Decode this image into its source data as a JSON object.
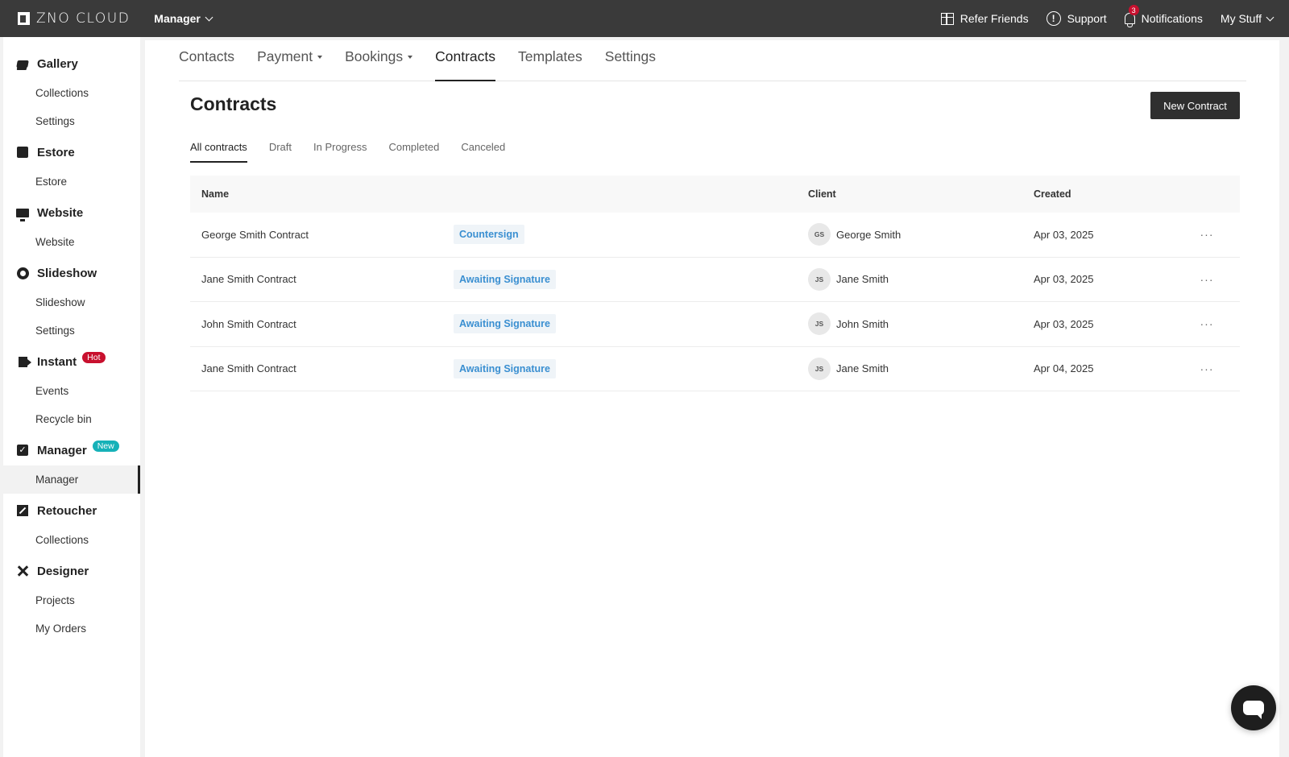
{
  "topbar": {
    "logo": "ZNO CLOUD",
    "app_switch": "Manager",
    "refer": "Refer Friends",
    "support": "Support",
    "support_glyph": "!",
    "notifications": "Notifications",
    "notif_count": "3",
    "my_stuff": "My Stuff"
  },
  "sidebar": {
    "gallery": {
      "label": "Gallery",
      "subs": [
        "Collections",
        "Settings"
      ]
    },
    "estore": {
      "label": "Estore",
      "subs": [
        "Estore"
      ]
    },
    "website": {
      "label": "Website",
      "subs": [
        "Website"
      ]
    },
    "slideshow": {
      "label": "Slideshow",
      "subs": [
        "Slideshow",
        "Settings"
      ]
    },
    "instant": {
      "label": "Instant",
      "pill": "Hot",
      "subs": [
        "Events",
        "Recycle bin"
      ]
    },
    "manager": {
      "label": "Manager",
      "pill": "New",
      "subs": [
        "Manager"
      ]
    },
    "retoucher": {
      "label": "Retoucher",
      "subs": [
        "Collections"
      ]
    },
    "designer": {
      "label": "Designer",
      "subs": [
        "Projects",
        "My Orders"
      ]
    }
  },
  "nav": {
    "contacts": "Contacts",
    "payment": "Payment",
    "bookings": "Bookings",
    "contracts": "Contracts",
    "templates": "Templates",
    "settings": "Settings"
  },
  "page": {
    "title": "Contracts",
    "new_button": "New Contract"
  },
  "subtabs": [
    "All contracts",
    "Draft",
    "In Progress",
    "Completed",
    "Canceled"
  ],
  "table": {
    "headers": {
      "name": "Name",
      "client": "Client",
      "created": "Created"
    },
    "more_glyph": "···",
    "rows": [
      {
        "name": "George Smith Contract",
        "status": "Countersign",
        "initials": "GS",
        "client": "George Smith",
        "created": "Apr 03, 2025"
      },
      {
        "name": "Jane Smith Contract",
        "status": "Awaiting Signature",
        "initials": "JS",
        "client": "Jane Smith",
        "created": "Apr 03, 2025"
      },
      {
        "name": "John Smith Contract",
        "status": "Awaiting Signature",
        "initials": "JS",
        "client": "John Smith",
        "created": "Apr 03, 2025"
      },
      {
        "name": "Jane Smith Contract",
        "status": "Awaiting Signature",
        "initials": "JS",
        "client": "Jane Smith",
        "created": "Apr 04, 2025"
      }
    ]
  },
  "colors": {
    "topbar": "#3a3a3a",
    "status_text": "#3a8fd1",
    "hot": "#c8102e",
    "new": "#16b1b8"
  }
}
